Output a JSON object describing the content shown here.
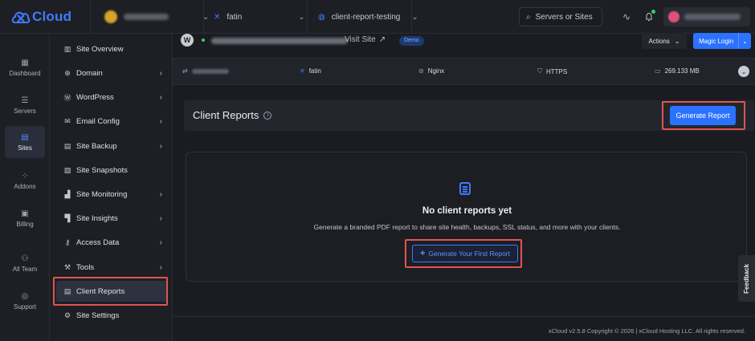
{
  "app": {
    "brand": "Cloud",
    "accent": "#2b72ff",
    "highlight": "#e0554f"
  },
  "topbar": {
    "server_name": "fatin",
    "site_name": "client-report-testing",
    "search_placeholder": "Servers or Sites"
  },
  "rail": [
    {
      "label": "Dashboard",
      "icon": "grid-icon"
    },
    {
      "label": "Servers",
      "icon": "server-icon"
    },
    {
      "label": "Sites",
      "icon": "sites-icon",
      "active": true
    },
    {
      "label": "Addons",
      "icon": "addons-icon"
    },
    {
      "label": "Billing",
      "icon": "billing-icon"
    },
    {
      "label": "All Team",
      "icon": "team-icon"
    },
    {
      "label": "Support",
      "icon": "support-icon"
    }
  ],
  "menu": [
    {
      "label": "Site Overview",
      "chevron": false
    },
    {
      "label": "Domain",
      "chevron": true
    },
    {
      "label": "WordPress",
      "chevron": true
    },
    {
      "label": "Email Config",
      "chevron": true
    },
    {
      "label": "Site Backup",
      "chevron": true
    },
    {
      "label": "Site Snapshots",
      "chevron": false
    },
    {
      "label": "Site Monitoring",
      "chevron": true
    },
    {
      "label": "Site Insights",
      "chevron": true
    },
    {
      "label": "Access Data",
      "chevron": true
    },
    {
      "label": "Tools",
      "chevron": true
    },
    {
      "label": "Client Reports",
      "chevron": false,
      "active": true
    },
    {
      "label": "Site Settings",
      "chevron": false
    }
  ],
  "site_bar": {
    "visit_site": "Visit Site",
    "badge": "Demo",
    "actions": "Actions",
    "magic_login": "Magic Login"
  },
  "info_bar": {
    "server": "fatin",
    "web_server": "Nginx",
    "ssl": "HTTPS",
    "disk": "269.133 MB"
  },
  "client_reports": {
    "title": "Client Reports",
    "generate_button": "Generate Report",
    "empty_title": "No client reports yet",
    "empty_description": "Generate a branded PDF report to share site health, backups, SSL status, and more with your clients.",
    "first_button": "Generate Your First Report"
  },
  "footer": {
    "text": "xCloud v2.5.8 Copyright © 2026 | xCloud Hosting LLC. All rights reserved."
  },
  "feedback": "Feedback"
}
